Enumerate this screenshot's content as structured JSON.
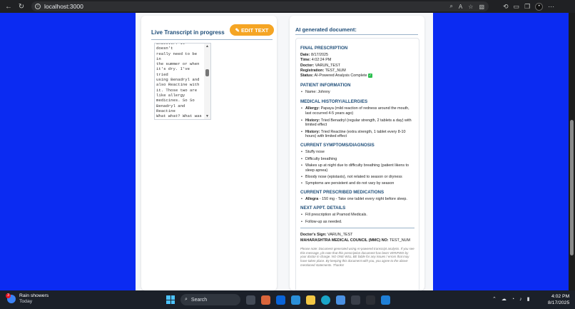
{
  "browser": {
    "url": "localhost:3000"
  },
  "left_panel": {
    "title": "Live Transcript in progress",
    "edit_button": "EDIT TEXT",
    "transcript": "Whatever. It doesn't\nreally need to be in\nthe summer or when\nit's dry. I've tried\nusing Benadryl and\nalso Reactine with\nit. Those two are\nlike allergy\nmedicines. So So\nBenadryl and Reactine\nWhat what? What was\nthe dosage and how\noften did you take\nit? I think the\nregular strength"
  },
  "right_panel": {
    "title": "AI generated document:",
    "doc": {
      "heading": "FINAL PRESCRIPTION",
      "date_label": "Date:",
      "date": "8/17/2025",
      "time_label": "Time:",
      "time": "4:02:24 PM",
      "doctor_label": "Doctor:",
      "doctor": "VARUN_TEST",
      "registration_label": "Registration:",
      "registration": "TEST_NUM",
      "status_label": "Status:",
      "status": "AI-Powered Analysis Complete",
      "patient_heading": "PATIENT INFORMATION",
      "patient_name": "Name: Johnny",
      "history_heading": "MEDICAL HISTORY/ALLERGIES",
      "history": [
        {
          "label": "Allergy:",
          "text": "Papaya (mild reaction of redness around the mouth, last occurred 4-5 years ago)"
        },
        {
          "label": "History:",
          "text": "Tried Benadryl (regular strength, 2 tablets a day) with limited effect"
        },
        {
          "label": "History:",
          "text": "Tried Reactine (extra strength, 1 tablet every 8-10 hours) with limited effect"
        }
      ],
      "symptoms_heading": "CURRENT SYMPTOMS/DIAGNOSIS",
      "symptoms": [
        "Stuffy nose",
        "Difficulty breathing",
        "Wakes up at night due to difficulty breathing (patient likens to sleep apnea)",
        "Bloody nose (epistaxis), not related to season or dryness",
        "Symptoms are persistent and do not vary by season"
      ],
      "meds_heading": "CURRENT PRESCRIBED MEDICATIONS",
      "med_name": "Allegra",
      "med_text": " - 150 mg - Take one tablet every night before sleep.",
      "next_heading": "NEXT APPT. DETAILS",
      "next": [
        "Fill prescription at Pramod Medicals.",
        "Follow-up as needed."
      ],
      "sign_label": "Doctor's Sign:",
      "sign": "VARUN_TEST",
      "council_label": "MAHARASHTRA MEDICAL COUNCIL (MMC) NO:",
      "council": "TEST_NUM",
      "note": "Please note: Document generated using AI-powered transcript analysis. If you see this message, pls note that this prescription document has been VERIFIED by your doctor in charge. NO ONE WILL BE liable for any issues / errors that may have taken place. By keeping this document with you, you agree to the above mentioned statements. Thanks!"
    }
  },
  "taskbar": {
    "weather_badge": "3",
    "weather_title": "Rain showers",
    "weather_sub": "Today",
    "search": "Search",
    "time": "4:02 PM",
    "date": "8/17/2025"
  },
  "colors": {
    "page_bg": "#0b2bf2",
    "accent_button": "#f5a524",
    "heading_blue": "#1f4e79"
  }
}
